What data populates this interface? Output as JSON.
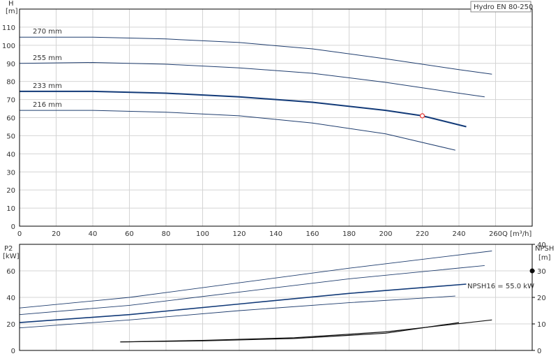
{
  "chart_data": [
    {
      "type": "line",
      "title": "Hydro EN 80-250",
      "ylabel_line1": "H",
      "ylabel_line2": "[m]",
      "xlabel": "Q [m³/h]",
      "xlim": [
        0,
        280
      ],
      "ylim": [
        0,
        120
      ],
      "x_ticks": [
        0,
        20,
        40,
        60,
        80,
        100,
        120,
        140,
        160,
        180,
        200,
        220,
        240,
        260
      ],
      "y_ticks": [
        0,
        10,
        20,
        30,
        40,
        50,
        60,
        70,
        80,
        90,
        100,
        110
      ],
      "grid": true,
      "series": [
        {
          "name": "270 mm",
          "x": [
            0,
            40,
            80,
            120,
            160,
            200,
            240,
            258
          ],
          "y": [
            104.5,
            104.5,
            103.5,
            101.5,
            98,
            92.5,
            86.5,
            84
          ]
        },
        {
          "name": "255 mm",
          "x": [
            0,
            40,
            80,
            120,
            160,
            200,
            240,
            254
          ],
          "y": [
            90,
            90.5,
            89.5,
            87.5,
            84.5,
            79.5,
            73.5,
            71.5
          ]
        },
        {
          "name": "233 mm",
          "x": [
            0,
            40,
            80,
            120,
            160,
            200,
            220,
            244
          ],
          "y": [
            74.5,
            74.5,
            73.5,
            71.5,
            68.5,
            64,
            61,
            55
          ],
          "emphasized": true
        },
        {
          "name": "216 mm",
          "x": [
            0,
            40,
            80,
            120,
            160,
            200,
            238
          ],
          "y": [
            64,
            64,
            63,
            61,
            57,
            51,
            42
          ]
        }
      ],
      "duty_point": {
        "x": 220,
        "y": 61
      },
      "colors": {
        "curve": "#1f3d6e",
        "emphasized": "#123a78",
        "duty_point": "#e53935"
      }
    },
    {
      "type": "line",
      "ylabel_left_line1": "P2",
      "ylabel_left_line2": "[kW]",
      "ylabel_right_line1": "NPSH",
      "ylabel_right_line2": "[m]",
      "xlim": [
        0,
        280
      ],
      "ylim_left": [
        0,
        80
      ],
      "ylim_right": [
        0,
        40
      ],
      "y_ticks_left": [
        0,
        20,
        40,
        60
      ],
      "y_ticks_right": [
        0,
        10,
        20,
        30,
        40
      ],
      "grid": true,
      "annotation": "NPSH16 = 55.0 kW",
      "annotation_value": {
        "axis": "NPSH",
        "y": 30
      },
      "power_series": [
        {
          "x": [
            0,
            60,
            120,
            180,
            258
          ],
          "y": [
            32,
            40,
            51,
            62,
            75
          ]
        },
        {
          "x": [
            0,
            60,
            120,
            180,
            254
          ],
          "y": [
            27,
            34,
            44,
            54,
            64
          ]
        },
        {
          "x": [
            0,
            60,
            120,
            180,
            244
          ],
          "y": [
            21,
            27,
            35,
            43,
            50
          ],
          "emphasized": true
        },
        {
          "x": [
            0,
            60,
            120,
            180,
            238
          ],
          "y": [
            17,
            23,
            30,
            36,
            41
          ]
        }
      ],
      "npsh_series": [
        {
          "x": [
            55,
            100,
            150,
            200,
            240
          ],
          "y": [
            3.2,
            3.6,
            4.5,
            6.5,
            10.5
          ]
        },
        {
          "x": [
            55,
            100,
            150,
            200,
            258
          ],
          "y": [
            3.2,
            3.8,
            4.8,
            7,
            11.5
          ]
        }
      ],
      "colors": {
        "curve": "#1f3d6e",
        "emphasized": "#123a78",
        "npsh": "#111111",
        "marker": "#111111"
      }
    }
  ]
}
